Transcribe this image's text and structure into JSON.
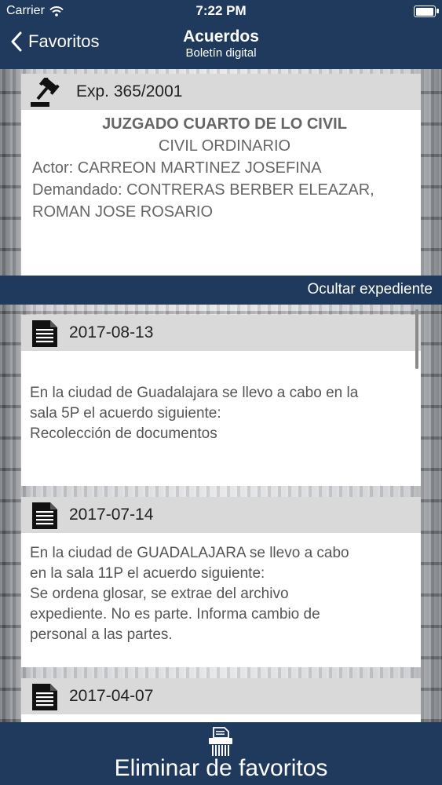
{
  "status_bar": {
    "carrier": "Carrier",
    "time": "7:22 PM"
  },
  "nav": {
    "back_label": "Favoritos",
    "title": "Acuerdos",
    "subtitle": "Boletín digital"
  },
  "expediente": {
    "number": "Exp. 365/2001",
    "court": "JUZGADO CUARTO DE LO CIVIL",
    "type": "CIVIL ORDINARIO",
    "actor": "Actor: CARREON MARTINEZ JOSEFINA",
    "defendant_line1": "Demandado: CONTRERAS BERBER ELEAZAR,",
    "defendant_line2": "ROMAN JOSE ROSARIO"
  },
  "hide_label": "Ocultar expediente",
  "acuerdos": [
    {
      "date": "2017-08-13",
      "lines": [
        "En la ciudad de Guadalajara se llevo a cabo en la",
        "sala 5P el acuerdo siguiente:",
        "Recolección de documentos"
      ]
    },
    {
      "date": "2017-07-14",
      "lines": [
        "En la ciudad de GUADALAJARA se llevo a cabo",
        "en la sala 11P el acuerdo siguiente:",
        "Se ordena glosar, se extrae del archivo",
        "expediente. No es parte. Informa cambio de",
        "personal a las partes."
      ]
    },
    {
      "date": "2017-04-07"
    }
  ],
  "footer": {
    "label": "Eliminar de favoritos"
  },
  "icons": {
    "back": "chevron-left-icon",
    "wifi": "wifi-icon",
    "battery": "battery-icon",
    "expediente": "gavel-icon",
    "acuerdo": "document-icon",
    "delete": "shredder-icon"
  },
  "colors": {
    "navy": "#1f3a5c",
    "card_header": "#d9d9d9",
    "card_bg": "#ffffff"
  }
}
